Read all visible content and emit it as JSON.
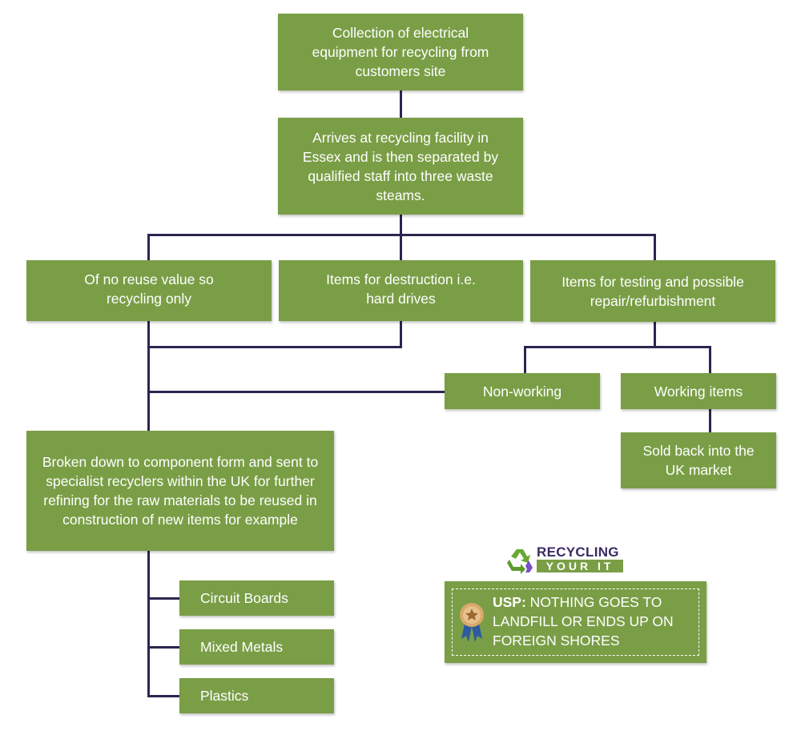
{
  "colors": {
    "box": "#7a9e46",
    "connector": "#2e2450",
    "logo_text": "#3a2a63"
  },
  "steps": {
    "collection": "Collection of electrical equipment for recycling from customers site",
    "arrives": "Arrives at recycling facility in Essex and is then separated by qualified staff into three waste steams.",
    "no_reuse": "Of no reuse value so recycling only",
    "destruction": "Items for destruction i.e. hard drives",
    "testing": "Items for testing and possible repair/refurbishment",
    "non_working": "Non-working",
    "working": "Working items",
    "sold": "Sold back into the UK market",
    "broken_down": "Broken down to component form and sent to specialist recyclers within the UK for further refining for the raw materials to be reused in construction of new items for example",
    "materials": [
      "Circuit Boards",
      "Mixed Metals",
      "Plastics"
    ]
  },
  "logo": {
    "line1": "RECYCLING",
    "line2": "YOUR IT",
    "icon": "recycle-icon"
  },
  "usp": {
    "label": "USP:",
    "text": " NOTHING GOES TO LANDFILL OR ENDS UP ON FOREIGN SHORES",
    "icon": "award-ribbon-icon"
  }
}
